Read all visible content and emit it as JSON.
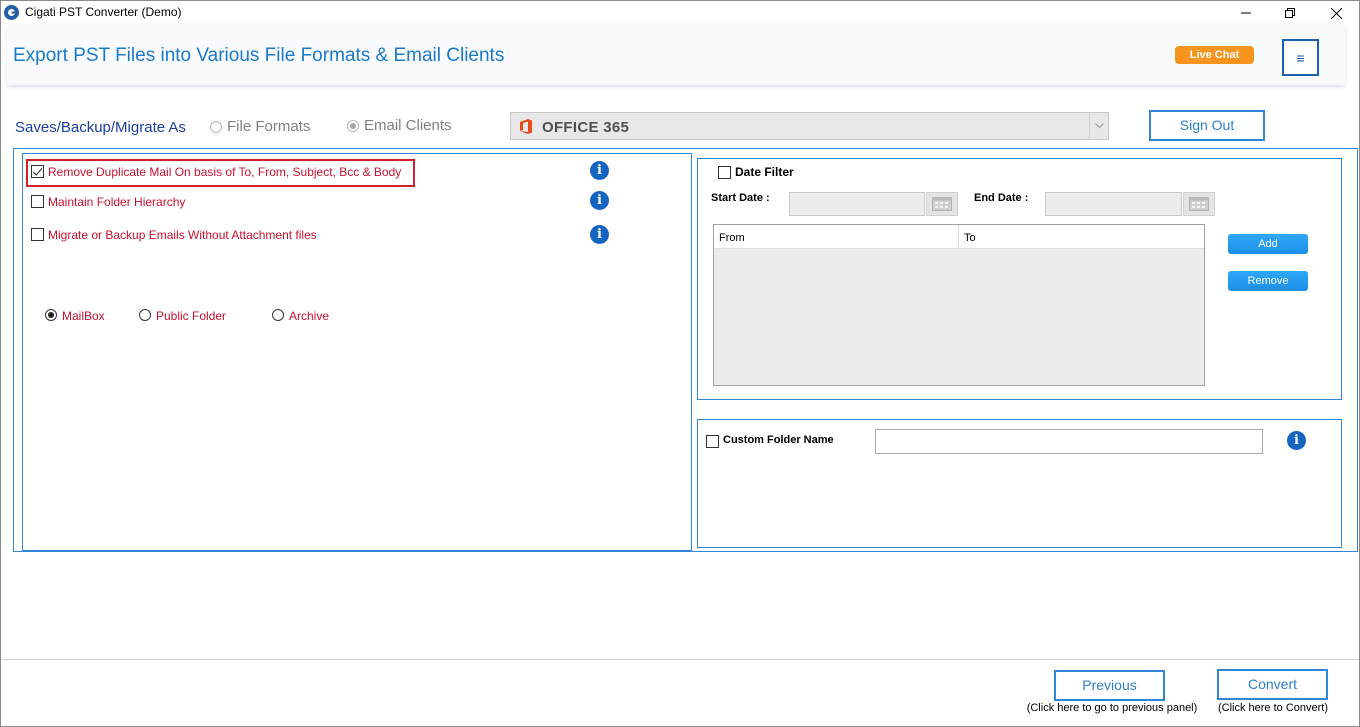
{
  "window": {
    "title": "Cigati PST Converter (Demo)",
    "controls": [
      "minimize",
      "maximize",
      "close"
    ]
  },
  "header": {
    "title": "Export PST Files into Various File Formats & Email Clients",
    "live_chat_label": "Live Chat",
    "menu_icon": "≡"
  },
  "save_as": {
    "label": "Saves/Backup/Migrate As",
    "options": [
      {
        "label": "File Formats",
        "selected": false,
        "enabled": false
      },
      {
        "label": "Email Clients",
        "selected": true,
        "enabled": false
      }
    ],
    "target_value": "OFFICE 365",
    "target_icon": "office-365-icon",
    "sign_out_label": "Sign Out"
  },
  "options_panel": {
    "checkboxes": [
      {
        "label": "Remove Duplicate Mail On basis of To, From, Subject, Bcc & Body",
        "checked": true
      },
      {
        "label": "Maintain Folder Hierarchy",
        "checked": false
      },
      {
        "label": "Migrate or Backup Emails Without Attachment files",
        "checked": false
      }
    ],
    "mailbox_types": [
      {
        "label": "MailBox",
        "selected": true
      },
      {
        "label": "Public Folder",
        "selected": false
      },
      {
        "label": "Archive",
        "selected": false
      }
    ]
  },
  "date_filter": {
    "label": "Date Filter",
    "checked": false,
    "start_date_label": "Start Date :",
    "start_date_value": "",
    "end_date_label": "End Date :",
    "end_date_value": "",
    "columns": [
      "From",
      "To"
    ],
    "rows": [],
    "add_label": "Add",
    "remove_label": "Remove"
  },
  "custom_folder": {
    "label": "Custom Folder Name",
    "checked": false,
    "value": ""
  },
  "footer": {
    "previous_label": "Previous",
    "previous_hint": "(Click here to go to previous panel)",
    "convert_label": "Convert",
    "convert_hint": "(Click here to Convert)"
  },
  "colors": {
    "accent_blue": "#1a7ac8",
    "panel_border": "#2f87d6",
    "label_red": "#c8102e",
    "live_chat_orange": "#f7941d",
    "info_blue": "#1565c0"
  }
}
